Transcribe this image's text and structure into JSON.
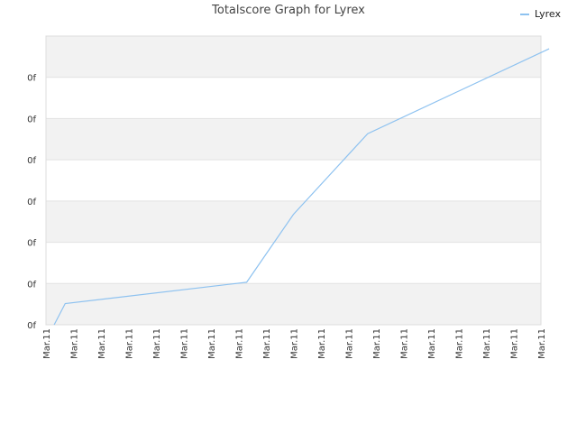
{
  "chart_data": {
    "type": "line",
    "title": "Totalscore Graph for Lyrex",
    "xlabel": "",
    "ylabel": "",
    "legend_position": "top-right",
    "grid": true,
    "y_ticks": [
      "0f",
      "0f",
      "0f",
      "0f",
      "0f",
      "0f",
      "0f"
    ],
    "x_ticks": [
      "Mar.11",
      "Mar.11",
      "Mar.11",
      "Mar.11",
      "Mar.11",
      "Mar.11",
      "Mar.11",
      "Mar.11",
      "Mar.11",
      "Mar.11",
      "Mar.11",
      "Mar.11",
      "Mar.11",
      "Mar.11",
      "Mar.11",
      "Mar.11",
      "Mar.11",
      "Mar.11",
      "Mar.11"
    ],
    "ylim": [
      0,
      6.8
    ],
    "series": [
      {
        "name": "Lyrex",
        "color": "#8ec2f0",
        "x": [
          0.3,
          0.7,
          7.3,
          9.0,
          11.7,
          18.3
        ],
        "y": [
          0.0,
          0.5,
          1.0,
          2.6,
          4.5,
          6.5
        ]
      }
    ]
  }
}
